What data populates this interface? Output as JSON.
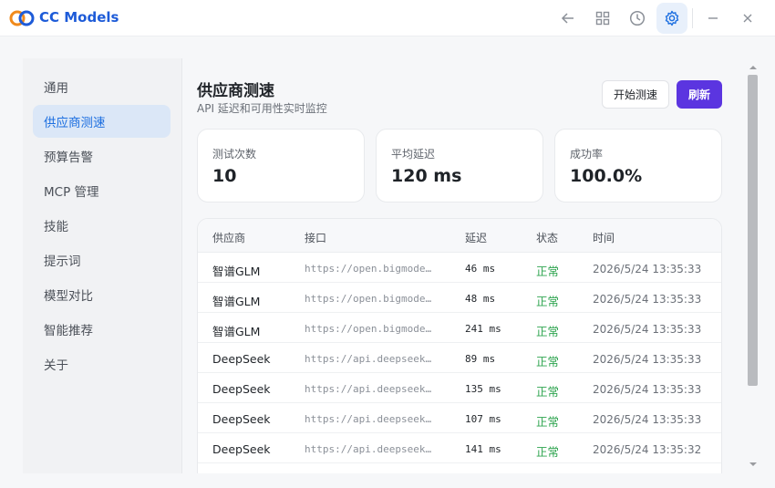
{
  "app": {
    "title": "CC Models"
  },
  "toolbar": {
    "back_icon": "arrow-left-icon",
    "grid_icon": "grid-icon",
    "history_icon": "clock-icon",
    "settings_icon": "gear-icon",
    "minimize_icon": "minimize-icon",
    "close_icon": "close-icon"
  },
  "colors": {
    "accent": "#1d6fe0",
    "primary_button": "#5b35e0",
    "status_ok": "#2ea44f"
  },
  "sidebar": {
    "items": [
      {
        "label": "通用"
      },
      {
        "label": "供应商测速"
      },
      {
        "label": "预算告警"
      },
      {
        "label": "MCP 管理"
      },
      {
        "label": "技能"
      },
      {
        "label": "提示词"
      },
      {
        "label": "模型对比"
      },
      {
        "label": "智能推荐"
      },
      {
        "label": "关于"
      }
    ],
    "active_index": 1
  },
  "main": {
    "title": "供应商测速",
    "subtitle": "API 延迟和可用性实时监控",
    "start_button": "开始测速",
    "refresh_button": "刷新",
    "stats": [
      {
        "label": "测试次数",
        "value": "10"
      },
      {
        "label": "平均延迟",
        "value": "120 ms"
      },
      {
        "label": "成功率",
        "value": "100.0%"
      }
    ],
    "table": {
      "headers": [
        "供应商",
        "接口",
        "延迟",
        "状态",
        "时间"
      ],
      "rows": [
        {
          "provider": "智谱GLM",
          "endpoint": "https://open.bigmodel.cn",
          "latency": "46 ms",
          "status": "正常",
          "time": "2026/5/24 13:35:33"
        },
        {
          "provider": "智谱GLM",
          "endpoint": "https://open.bigmodel.cn",
          "latency": "48 ms",
          "status": "正常",
          "time": "2026/5/24 13:35:33"
        },
        {
          "provider": "智谱GLM",
          "endpoint": "https://open.bigmodel.cn",
          "latency": "241 ms",
          "status": "正常",
          "time": "2026/5/24 13:35:33"
        },
        {
          "provider": "DeepSeek",
          "endpoint": "https://api.deepseek.com",
          "latency": "89 ms",
          "status": "正常",
          "time": "2026/5/24 13:35:33"
        },
        {
          "provider": "DeepSeek",
          "endpoint": "https://api.deepseek.com",
          "latency": "135 ms",
          "status": "正常",
          "time": "2026/5/24 13:35:33"
        },
        {
          "provider": "DeepSeek",
          "endpoint": "https://api.deepseek.com",
          "latency": "107 ms",
          "status": "正常",
          "time": "2026/5/24 13:35:33"
        },
        {
          "provider": "DeepSeek",
          "endpoint": "https://api.deepseek.com",
          "latency": "141 ms",
          "status": "正常",
          "time": "2026/5/24 13:35:32"
        }
      ]
    }
  }
}
